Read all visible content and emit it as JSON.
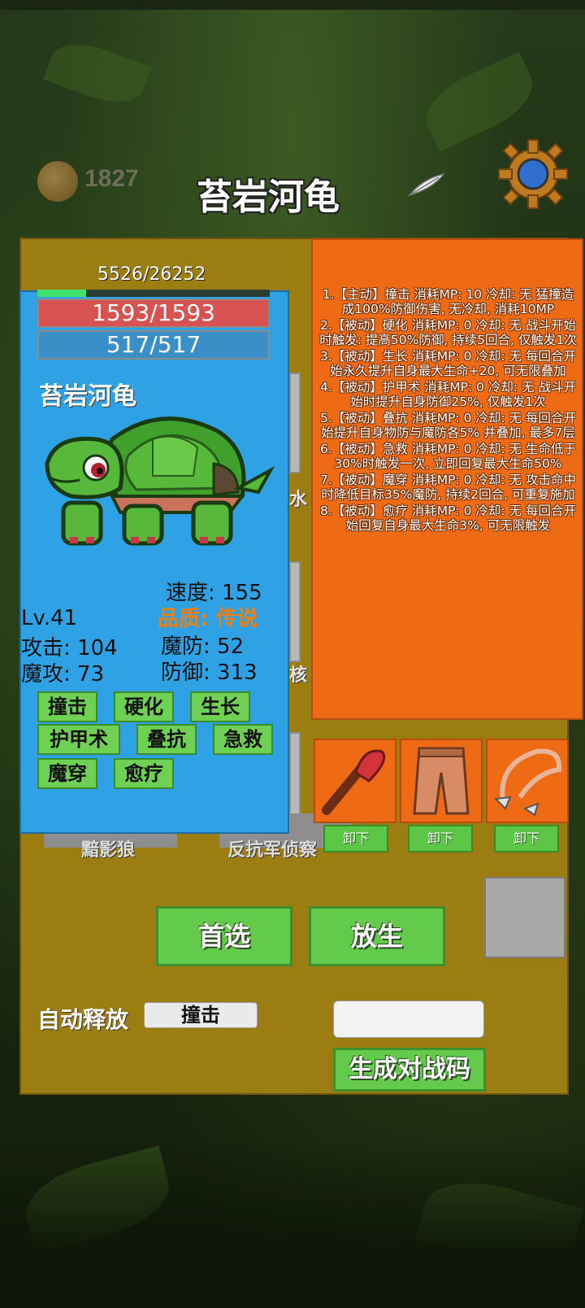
{
  "header": {
    "coin_count": "1827",
    "title": "苔岩河龟"
  },
  "pet": {
    "exp_text": "5526/26252",
    "exp_fraction": 0.21,
    "hp": "1593/1593",
    "mp": "517/517",
    "name": "苔岩河龟",
    "speed": "速度: 155",
    "quality": "品质: 传说",
    "level": "Lv.41",
    "attack": "攻击: 104",
    "magic_defense": "魔防: 52",
    "magic_attack": "魔攻: 73",
    "defense": "防御: 313",
    "skills": [
      "撞击",
      "硬化",
      "生长",
      "护甲术",
      "叠抗",
      "急救",
      "魔穿",
      "愈疗"
    ]
  },
  "skill_descriptions": [
    "1.【主动】撞击 消耗MP: 10 冷却: 无 猛撞造成100%防御伤害, 无冷却, 消耗10MP",
    "2.【被动】硬化 消耗MP: 0 冷却: 无 战斗开始时触发: 提高50%防御, 持续5回合, 仅触发1次",
    "3.【被动】生长 消耗MP: 0 冷却: 无 每回合开始永久提升自身最大生命+20, 可无限叠加",
    "4.【被动】护甲术 消耗MP: 0 冷却: 无 战斗开始时提升自身防御25%, 仅触发1次",
    "5.【被动】叠抗 消耗MP: 0 冷却: 无 每回合开始提升自身物防与魔防各5% 并叠加, 最多7层",
    "6.【被动】急救 消耗MP: 0 冷却: 无 生命低于30%时触发一次, 立即回复最大生命50%",
    "7.【被动】魔穿 消耗MP: 0 冷却: 无 攻击命中时降低目标35%魔防, 持续2回合, 可重复施加",
    "8.【被动】愈疗 消耗MP: 0 冷却: 无 每回合开始回复自身最大生命3%, 可无限触发"
  ],
  "equipment": {
    "unequip_label": "卸下",
    "items": [
      "club-icon",
      "pants-icon",
      "bow-icon"
    ]
  },
  "background_labels": {
    "left_label": "黯影狼",
    "mid_label": "反抗军侦察",
    "partial_1": "水",
    "partial_2": "核"
  },
  "actions": {
    "prefer_label": "首选",
    "release_label": "放生",
    "auto_release_label": "自动释放",
    "auto_release_value": "撞击",
    "code_input_value": "",
    "generate_code_label": "生成对战码"
  }
}
